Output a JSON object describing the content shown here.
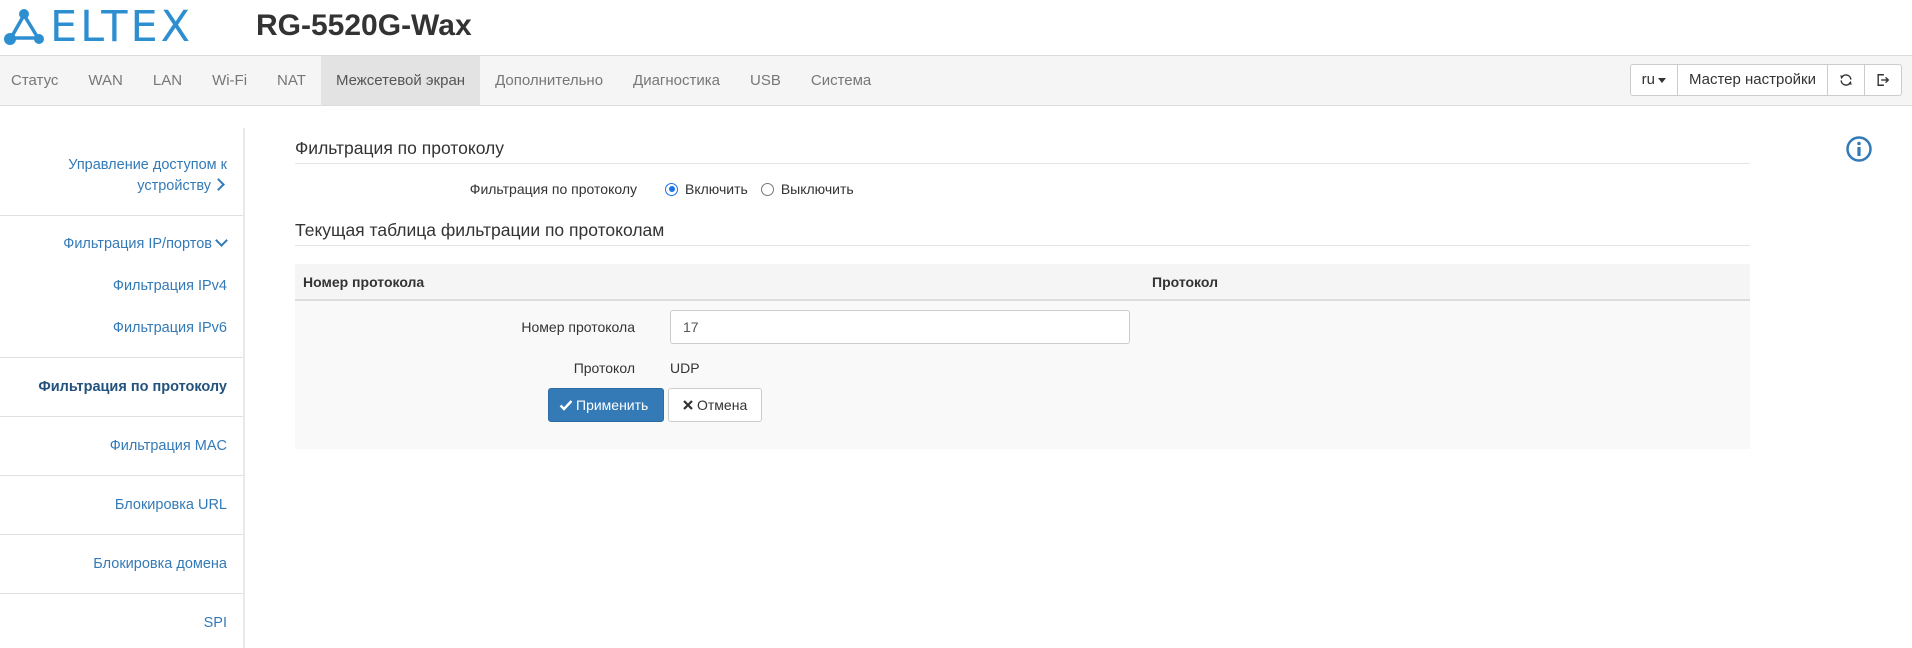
{
  "header": {
    "logo_text": "ELTEX",
    "device_title": "RG-5520G-Wax"
  },
  "nav": {
    "items": [
      {
        "label": "Статус"
      },
      {
        "label": "WAN"
      },
      {
        "label": "LAN"
      },
      {
        "label": "Wi-Fi"
      },
      {
        "label": "NAT"
      },
      {
        "label": "Межсетевой экран",
        "active": true
      },
      {
        "label": "Дополнительно"
      },
      {
        "label": "Диагностика"
      },
      {
        "label": "USB"
      },
      {
        "label": "Система"
      }
    ],
    "language": "ru",
    "wizard_label": "Мастер настройки"
  },
  "sidebar": {
    "items": [
      {
        "label_line1": "Управление доступом к",
        "label_line2": "устройству"
      },
      {
        "label": "Фильтрация IP/портов"
      },
      {
        "label": "Фильтрация IPv4"
      },
      {
        "label": "Фильтрация IPv6"
      },
      {
        "label": "Фильтрация по протоколу",
        "active": true
      },
      {
        "label": "Фильтрация MAC"
      },
      {
        "label": "Блокировка URL"
      },
      {
        "label": "Блокировка домена"
      },
      {
        "label": "SPI"
      }
    ]
  },
  "main": {
    "section1_title": "Фильтрация по протоколу",
    "protocol_filter": {
      "label": "Фильтрация по протоколу",
      "options": [
        "Включить",
        "Выключить"
      ],
      "selected": "Включить"
    },
    "section2_title": "Текущая таблица фильтрации по протоколам",
    "table": {
      "headers": [
        "Номер протокола",
        "Протокол"
      ],
      "form": {
        "number_label": "Номер протокола",
        "number_value": "17",
        "protocol_label": "Протокол",
        "protocol_value": "UDP",
        "apply_label": "Применить",
        "cancel_label": "Отмена"
      }
    }
  },
  "colors": {
    "brand": "#2e8fd0",
    "link": "#337ab7",
    "primary_button": "#337ab7",
    "nav_bg": "#f5f5f5"
  },
  "icons": [
    "eltex-logo-icon",
    "caret-down-icon",
    "refresh-icon",
    "logout-icon",
    "chevron-right-icon",
    "chevron-down-icon",
    "check-icon",
    "close-icon",
    "info-icon"
  ]
}
